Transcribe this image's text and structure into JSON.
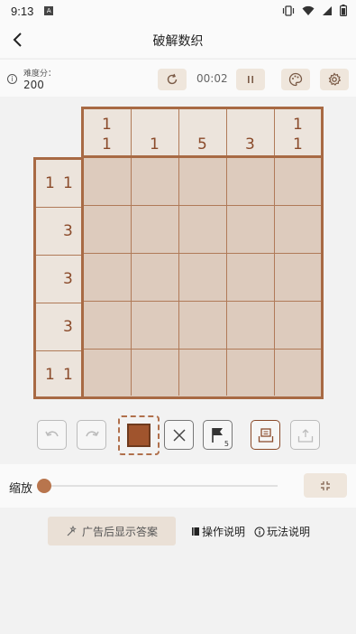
{
  "status_bar": {
    "time": "9:13",
    "notification_letter": "A"
  },
  "header": {
    "title": "破解数织",
    "back_icon": "back-arrow-icon"
  },
  "info_bar": {
    "difficulty_label": "难度分：",
    "difficulty_value": "200",
    "timer": "00:02"
  },
  "puzzle": {
    "rows": 5,
    "cols": 5,
    "column_clues": [
      [
        "1",
        "1"
      ],
      [
        "1"
      ],
      [
        "5"
      ],
      [
        "3"
      ],
      [
        "1",
        "1"
      ]
    ],
    "row_clues": [
      [
        "1",
        "1"
      ],
      [
        "3"
      ],
      [
        "3"
      ],
      [
        "3"
      ],
      [
        "1",
        "1"
      ]
    ],
    "filled_cells": []
  },
  "tools": {
    "flag_count": "5"
  },
  "zoom": {
    "label": "缩放",
    "level": 0
  },
  "bottom": {
    "ad_button_label": "广告后显示答案",
    "operation_help": "操作说明",
    "rules_help": "玩法说明"
  },
  "colors": {
    "accent": "#a86a44",
    "fill": "#a0542d",
    "cell_bg": "#ddcbbd",
    "clue_bg": "#ece4dc",
    "clue_text": "#8a4a2a"
  }
}
